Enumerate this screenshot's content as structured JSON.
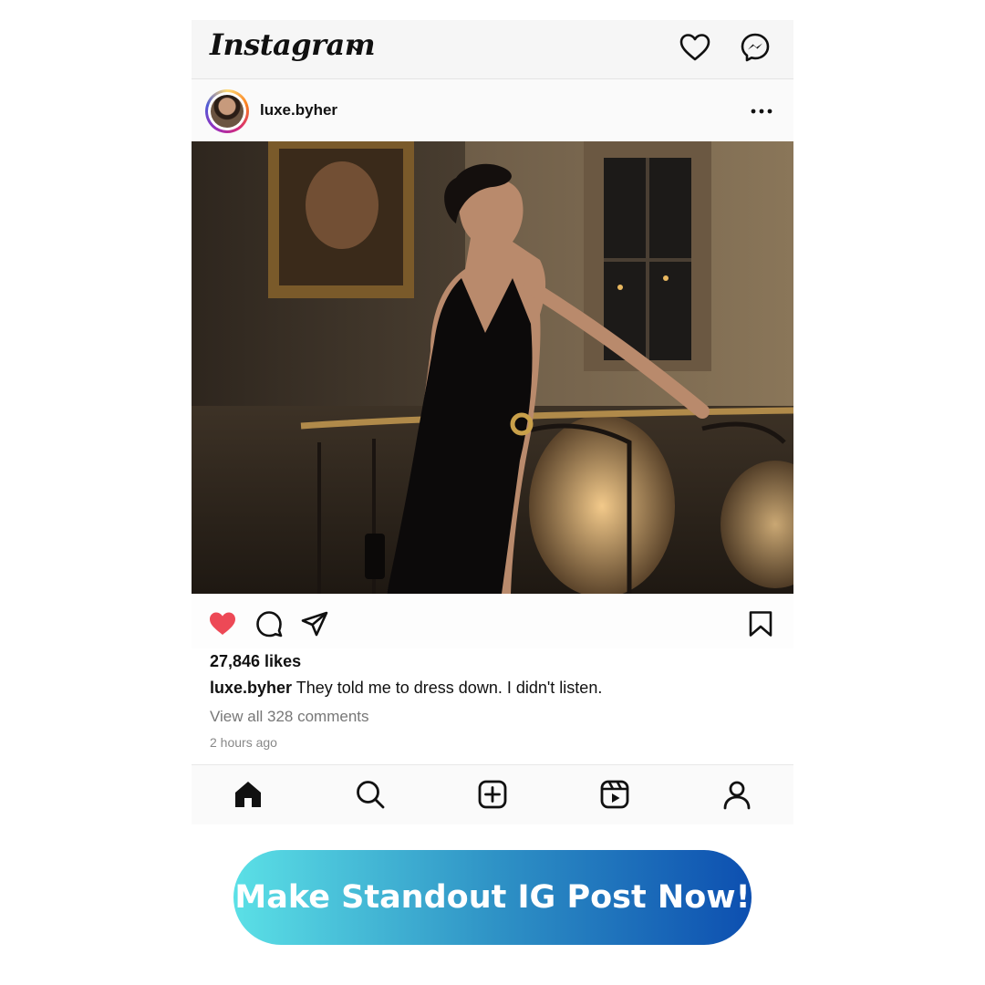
{
  "app": {
    "title": "Instagram"
  },
  "post": {
    "username": "luxe.byher",
    "likes": "27,846 likes",
    "caption_user": "luxe.byher",
    "caption_text": " They told me to dress down. I didn't listen.",
    "comments_link": "View all 328 comments",
    "timestamp": "2 hours ago",
    "liked": true
  },
  "icons": {
    "top": [
      "chevron-down-icon",
      "heart-icon",
      "messenger-icon"
    ],
    "actions": [
      "heart-filled-icon",
      "comment-icon",
      "share-icon",
      "bookmark-icon"
    ],
    "bottom_nav": [
      "home-icon",
      "search-icon",
      "create-icon",
      "reels-icon",
      "profile-icon"
    ]
  },
  "cta": {
    "label": "Make Standout IG Post Now!"
  },
  "colors": {
    "like_red": "#ed4956",
    "cta_gradient_start": "#5be0e6",
    "cta_gradient_end": "#0d4fb0"
  }
}
